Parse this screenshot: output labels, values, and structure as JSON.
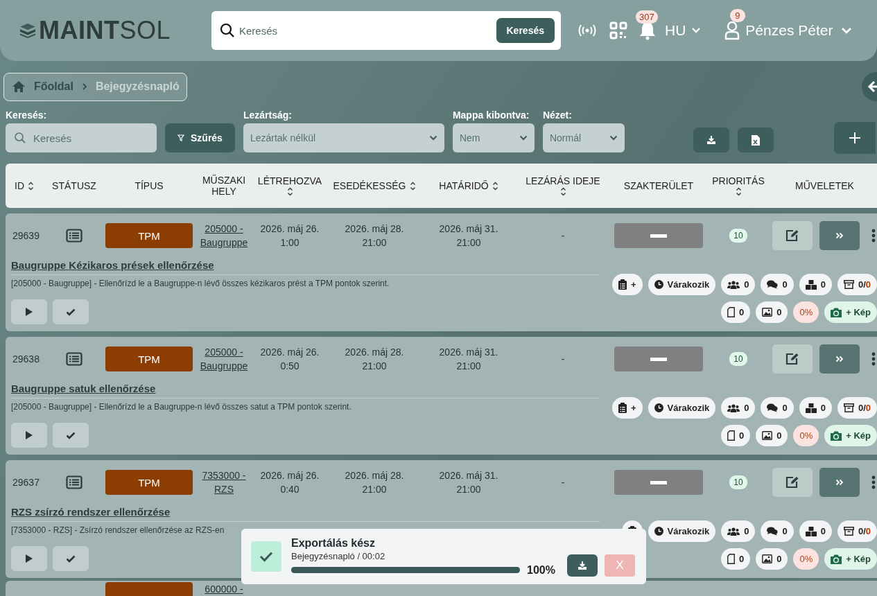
{
  "header": {
    "logo_bold": "MAINT",
    "logo_light": "SOL",
    "search": {
      "placeholder": "Keresés"
    },
    "search_button": "Keresés",
    "notifications": "307",
    "language": "HU",
    "user_badge": "9",
    "user_name": "Pénzes Péter"
  },
  "breadcrumb": [
    "Főoldal",
    "Bejegyzésnapló"
  ],
  "filters": {
    "search": {
      "label": "Keresés:",
      "placeholder": "Keresés"
    },
    "filter_button": "Szűrés",
    "selects": [
      {
        "label": "Lezártság:",
        "value": "Lezártak nélkül",
        "kind": "wide"
      },
      {
        "label": "Mappa kibontva:",
        "value": "Nem",
        "kind": "narrow"
      },
      {
        "label": "Nézet:",
        "value": "Normál",
        "kind": "narrow"
      }
    ]
  },
  "columns": [
    {
      "label": "ID",
      "sortable": true,
      "icon_below": false
    },
    {
      "label": "STÁTUSZ",
      "sortable": false
    },
    {
      "label": "TÍPUS",
      "sortable": false
    },
    {
      "label": "MŰSZAKI HELY",
      "sortable": false
    },
    {
      "label": "LÉTREHOZVA",
      "sortable": true,
      "icon_below": true
    },
    {
      "label": "ESEDÉKESSÉG",
      "sortable": true,
      "icon_below": false
    },
    {
      "label": "HATÁRIDŐ",
      "sortable": true,
      "icon_below": false
    },
    {
      "label": "LEZÁRÁS IDEJE",
      "sortable": true,
      "icon_below": true
    },
    {
      "label": "SZAKTERÜLET",
      "sortable": false
    },
    {
      "label": "PRIORITÁS",
      "sortable": true,
      "icon_below": true
    },
    {
      "label": "MŰVELETEK",
      "sortable": false
    }
  ],
  "rows": [
    {
      "id": "29639",
      "type": "TPM",
      "location": "205000 - Baugruppe",
      "created": "2026. máj 26. 1:00",
      "due": "2026. máj 28. 21:00",
      "deadline": "2026. máj 31. 21:00",
      "closed": "-",
      "priority": "10",
      "title": "Baugruppe Kézikaros prések ellenőrzése",
      "description": "[205000 - Baugruppe] - Ellenőrízd le a Baugruppe-n lévő összes kézikaros prést a TPM pontok szerint.",
      "task_add": "+",
      "status": "Várakozik",
      "people": "0",
      "comments": "0",
      "parts": "0",
      "archive_done": "0/",
      "archive_total": "0",
      "documents": "0",
      "images": "0",
      "progress": "0%",
      "photo_button": "+ Kép"
    },
    {
      "id": "29638",
      "type": "TPM",
      "location": "205000 - Baugruppe",
      "created": "2026. máj 26. 0:50",
      "due": "2026. máj 28. 21:00",
      "deadline": "2026. máj 31. 21:00",
      "closed": "-",
      "priority": "10",
      "title": "Baugruppe satuk ellenőrzése",
      "description": "[205000 - Baugruppe] - Ellenőrízd le a Baugruppe-n lévő összes satut a TPM pontok szerint.",
      "task_add": "+",
      "status": "Várakozik",
      "people": "0",
      "comments": "0",
      "parts": "0",
      "archive_done": "0/",
      "archive_total": "0",
      "documents": "0",
      "images": "0",
      "progress": "0%",
      "photo_button": "+ Kép"
    },
    {
      "id": "29637",
      "type": "TPM",
      "location": "7353000 - RZS",
      "created": "2026. máj 26. 0:40",
      "due": "2026. máj 28. 21:00",
      "deadline": "2026. máj 31. 21:00",
      "closed": "-",
      "priority": "10",
      "title": "RZS zsírzó rendszer ellenőrzése",
      "description": "[7353000 - RZS] - Zsírzó rendszer ellenőrzése az RZS-en",
      "status": "Várakozik",
      "people": "0",
      "comments": "0",
      "parts": "0",
      "archive_done": "0/",
      "archive_total": "0",
      "documents": "0",
      "images": "0",
      "progress": "0%",
      "photo_button": "+ Kép"
    }
  ],
  "partial_row": {
    "location": "600000 -"
  },
  "toast": {
    "title": "Exportálás kész",
    "subtitle": "Bejegyzésnapló / 00:02",
    "level": 1,
    "percent": "100%",
    "close": "X"
  }
}
